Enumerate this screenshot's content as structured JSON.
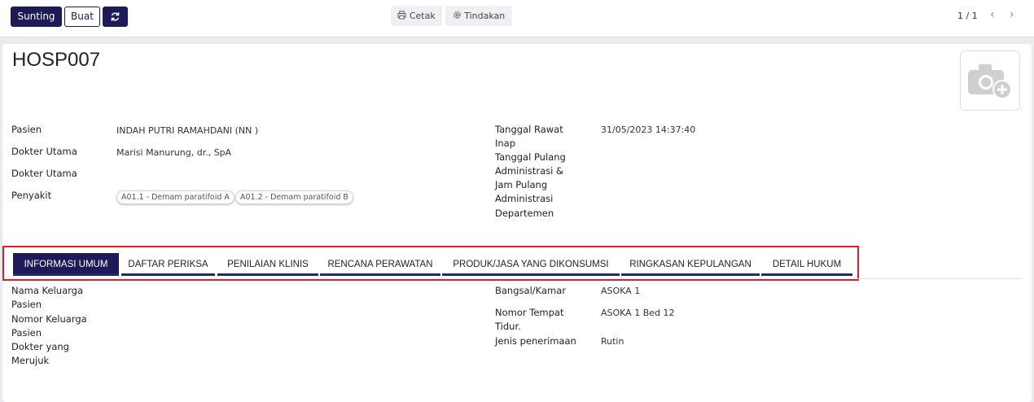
{
  "toolbar": {
    "edit_label": "Sunting",
    "create_label": "Buat",
    "print_label": "Cetak",
    "action_label": "Tindakan",
    "pager_text": "1 / 1"
  },
  "record": {
    "title": "HOSP007"
  },
  "fields_left": {
    "patient_label": "Pasien",
    "patient_value": "INDAH PUTRI RAMAHDANI (NN )",
    "doctor1_label": "Dokter Utama",
    "doctor1_value": "Marisi Manurung, dr., SpA",
    "doctor2_label": "Dokter Utama",
    "disease_label": "Penyakit",
    "disease_tags": [
      "A01.1 - Demam paratifoid A",
      "A01.2 - Demam paratifoid B"
    ]
  },
  "fields_right": {
    "admit_label_1": "Tanggal Rawat",
    "admit_label_2": "Inap",
    "admit_value": "31/05/2023 14:37:40",
    "discharge_label_1": "Tanggal Pulang",
    "discharge_label_2": "Administrasi &",
    "discharge_label_3": "Jam Pulang",
    "discharge_label_4": "Administrasi",
    "department_label": "Departemen"
  },
  "tabs": [
    {
      "label": "INFORMASI UMUM",
      "active": true
    },
    {
      "label": "DAFTAR PERIKSA",
      "active": false
    },
    {
      "label": "PENILAIAN KLINIS",
      "active": false
    },
    {
      "label": "RENCANA PERAWATAN",
      "active": false
    },
    {
      "label": "PRODUK/JASA YANG DIKONSUMSI",
      "active": false
    },
    {
      "label": "RINGKASAN KEPULANGAN",
      "active": false
    },
    {
      "label": "DETAIL HUKUM",
      "active": false
    }
  ],
  "general": {
    "family_name_label_1": "Nama Keluarga",
    "family_name_label_2": "Pasien",
    "family_no_label_1": "Nomor Keluarga",
    "family_no_label_2": "Pasien",
    "referrer_label_1": "Dokter yang",
    "referrer_label_2": "Merujuk",
    "ward_label": "Bangsal/Kamar",
    "ward_value": "ASOKA 1",
    "bed_label_1": "Nomor Tempat",
    "bed_label_2": "Tidur.",
    "bed_value": "ASOKA 1 Bed 12",
    "admission_type_label": "Jenis penerimaan",
    "admission_type_value": "Rutin"
  },
  "colors": {
    "primary": "#1d1a57",
    "highlight_border": "#e01e26"
  }
}
